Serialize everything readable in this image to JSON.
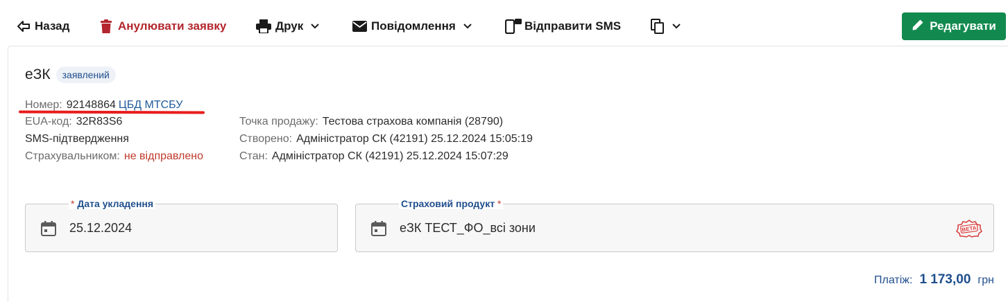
{
  "toolbar": {
    "back_label": "Назад",
    "cancel_label": "Анулювати заявку",
    "print_label": "Друк",
    "messages_label": "Повідомлення",
    "sms_label": "Відправити SMS",
    "edit_label": "Редагувати"
  },
  "header": {
    "title": "еЗК",
    "status": "заявлений"
  },
  "details": {
    "number_key": "Номер:",
    "number_value": "92148864",
    "number_link": "ЦБД МТСБУ",
    "eua_key": "EUA-код:",
    "eua_value": "32R83S6",
    "sms_line1": "SMS-підтвердження",
    "sms_key": "Страхувальником:",
    "sms_value": "не відправлено",
    "sale_key": "Точка продажу:",
    "sale_value": "Тестова страхова компанія (28790)",
    "created_key": "Створено:",
    "created_value": "Адміністратор СК (42191) 25.12.2024 15:05:19",
    "state_key": "Стан:",
    "state_value": "Адміністратор СК (42191) 25.12.2024 15:07:29"
  },
  "form": {
    "date_label": "Дата укладення",
    "date_value": "25.12.2024",
    "product_label": "Страховий продукт",
    "product_value": "еЗК ТЕСТ_ФО_всі зони",
    "required_mark": "*",
    "beta_badge": "BETA"
  },
  "payment": {
    "label": "Платіж:",
    "amount": "1 173,00",
    "currency": "грн"
  },
  "icons": {
    "back": "arrow-left-icon",
    "cancel": "trash-icon",
    "print": "printer-icon",
    "messages": "envelope-icon",
    "sms": "phone-sms-icon",
    "copy": "copy-icon",
    "edit": "pencil-icon",
    "calendar": "calendar-icon"
  },
  "colors": {
    "accent": "#1f4e8c",
    "danger": "#b3262d",
    "edit_button": "#128a4f",
    "annotation_underline": "#e81d1d"
  }
}
